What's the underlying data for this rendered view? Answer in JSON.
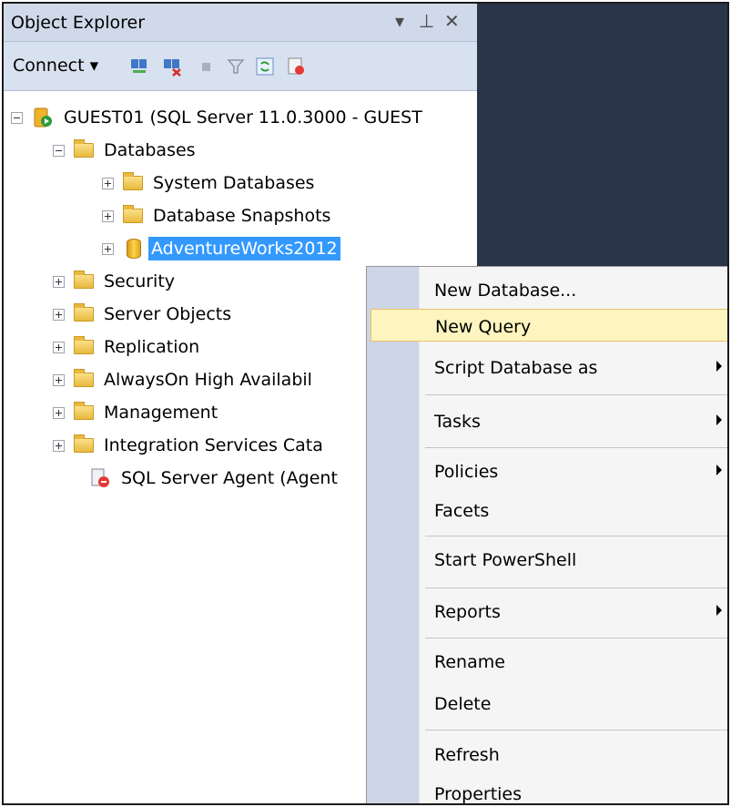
{
  "object_explorer": {
    "title": "Object Explorer",
    "pin_glyph": "▾ ⊥ ✕",
    "toolbar": {
      "connect_label": "Connect ▾"
    }
  },
  "tree": {
    "server": "GUEST01 (SQL Server 11.0.3000 - GUEST",
    "databases": "Databases",
    "system_databases": "System Databases",
    "database_snapshots": "Database Snapshots",
    "selected_db": "AdventureWorks2012",
    "security": "Security",
    "server_objects": "Server Objects",
    "replication": "Replication",
    "alwayson": "AlwaysOn High Availabil",
    "management": "Management",
    "integration": "Integration Services Cata",
    "agent": "SQL Server Agent (Agent"
  },
  "context_menu": {
    "items": [
      {
        "label": "New Database..."
      },
      {
        "label": "New Query"
      },
      {
        "label": "Script Database as"
      },
      {
        "label": "Tasks"
      },
      {
        "label": "Policies"
      },
      {
        "label": "Facets"
      },
      {
        "label": "Start PowerShell"
      },
      {
        "label": "Reports"
      },
      {
        "label": "Rename"
      },
      {
        "label": "Delete"
      },
      {
        "label": "Refresh"
      },
      {
        "label": "Properties"
      }
    ]
  },
  "colors": {
    "selection": "#3399ff",
    "menu_highlight": "#fdf4bf",
    "dark_background": "#2a3549"
  }
}
